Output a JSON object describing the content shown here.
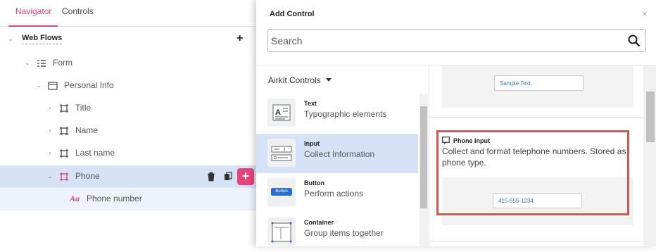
{
  "navigator": {
    "tabs": [
      {
        "label": "Navigator",
        "active": true
      },
      {
        "label": "Controls",
        "active": false
      }
    ],
    "accent_color": "#e5437a",
    "tree": [
      {
        "label": "Web Flows",
        "icon": "chevron-down-icon"
      },
      {
        "label": "Form",
        "icon": "form-icon"
      },
      {
        "label": "Personal Info",
        "icon": "container-icon"
      },
      {
        "label": "Title",
        "icon": "frame-icon"
      },
      {
        "label": "Name",
        "icon": "frame-icon"
      },
      {
        "label": "Last name",
        "icon": "frame-icon"
      },
      {
        "label": "Phone",
        "icon": "frame-icon",
        "selected": true
      },
      {
        "label": "Phone number",
        "icon": "text-icon"
      }
    ],
    "text_icon_glyph": "Aa"
  },
  "modal": {
    "title": "Add Control",
    "close_glyph": "×",
    "search": {
      "placeholder": "Search",
      "value": ""
    },
    "library": {
      "label": "Airkit Controls"
    },
    "controls": [
      {
        "name": "Text",
        "description": "Typographic elements",
        "icon": "text-control-icon"
      },
      {
        "name": "Input",
        "description": "Collect Information",
        "icon": "input-control-icon",
        "selected": true
      },
      {
        "name": "Button",
        "description": "Perform actions",
        "icon": "button-control-icon",
        "thumb_text": "Button"
      },
      {
        "name": "Container",
        "description": "Group items together",
        "icon": "container-control-icon"
      }
    ],
    "preview": {
      "sample_text": "Sample Text",
      "phone_input": {
        "name": "Phone Input",
        "description": "Collect and format telephone numbers. Stored as phone type.",
        "example_value": "415-555-1234"
      }
    },
    "highlight_color": "#d9534f"
  }
}
